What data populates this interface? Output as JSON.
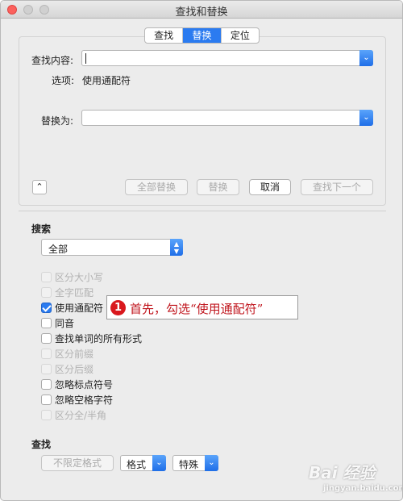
{
  "window": {
    "title": "查找和替换"
  },
  "tabs": [
    {
      "label": "查找",
      "active": false
    },
    {
      "label": "替换",
      "active": true
    },
    {
      "label": "定位",
      "active": false
    }
  ],
  "find": {
    "label": "查找内容:",
    "value": "",
    "options_label": "选项:",
    "options_value": "使用通配符"
  },
  "replace": {
    "label": "替换为:",
    "value": ""
  },
  "buttons": {
    "replace_all": "全部替换",
    "replace": "替换",
    "cancel": "取消",
    "find_next": "查找下一个"
  },
  "search": {
    "title": "搜索",
    "scope_selected": "全部"
  },
  "checkboxes": [
    {
      "label": "区分大小写",
      "checked": false,
      "enabled": false
    },
    {
      "label": "全字匹配",
      "checked": false,
      "enabled": false
    },
    {
      "label": "使用通配符",
      "checked": true,
      "enabled": true
    },
    {
      "label": "同音",
      "checked": false,
      "enabled": true
    },
    {
      "label": "查找单词的所有形式",
      "checked": false,
      "enabled": true
    },
    {
      "label": "区分前缀",
      "checked": false,
      "enabled": false
    },
    {
      "label": "区分后缀",
      "checked": false,
      "enabled": false
    },
    {
      "label": "忽略标点符号",
      "checked": false,
      "enabled": true
    },
    {
      "label": "忽略空格字符",
      "checked": false,
      "enabled": true
    },
    {
      "label": "区分全/半角",
      "checked": false,
      "enabled": false
    }
  ],
  "annotation": {
    "number": "1",
    "text": "首先，勾选“使用通配符”"
  },
  "find_format": {
    "title": "查找",
    "no_format": "不限定格式",
    "format": "格式",
    "special": "特殊"
  },
  "watermark": {
    "main": "Bai 经验",
    "sub": "jingyan.baidu.com"
  },
  "colors": {
    "accent": "#2b7bf0",
    "annotation": "#d9181d",
    "close_light": "#fc615d"
  }
}
